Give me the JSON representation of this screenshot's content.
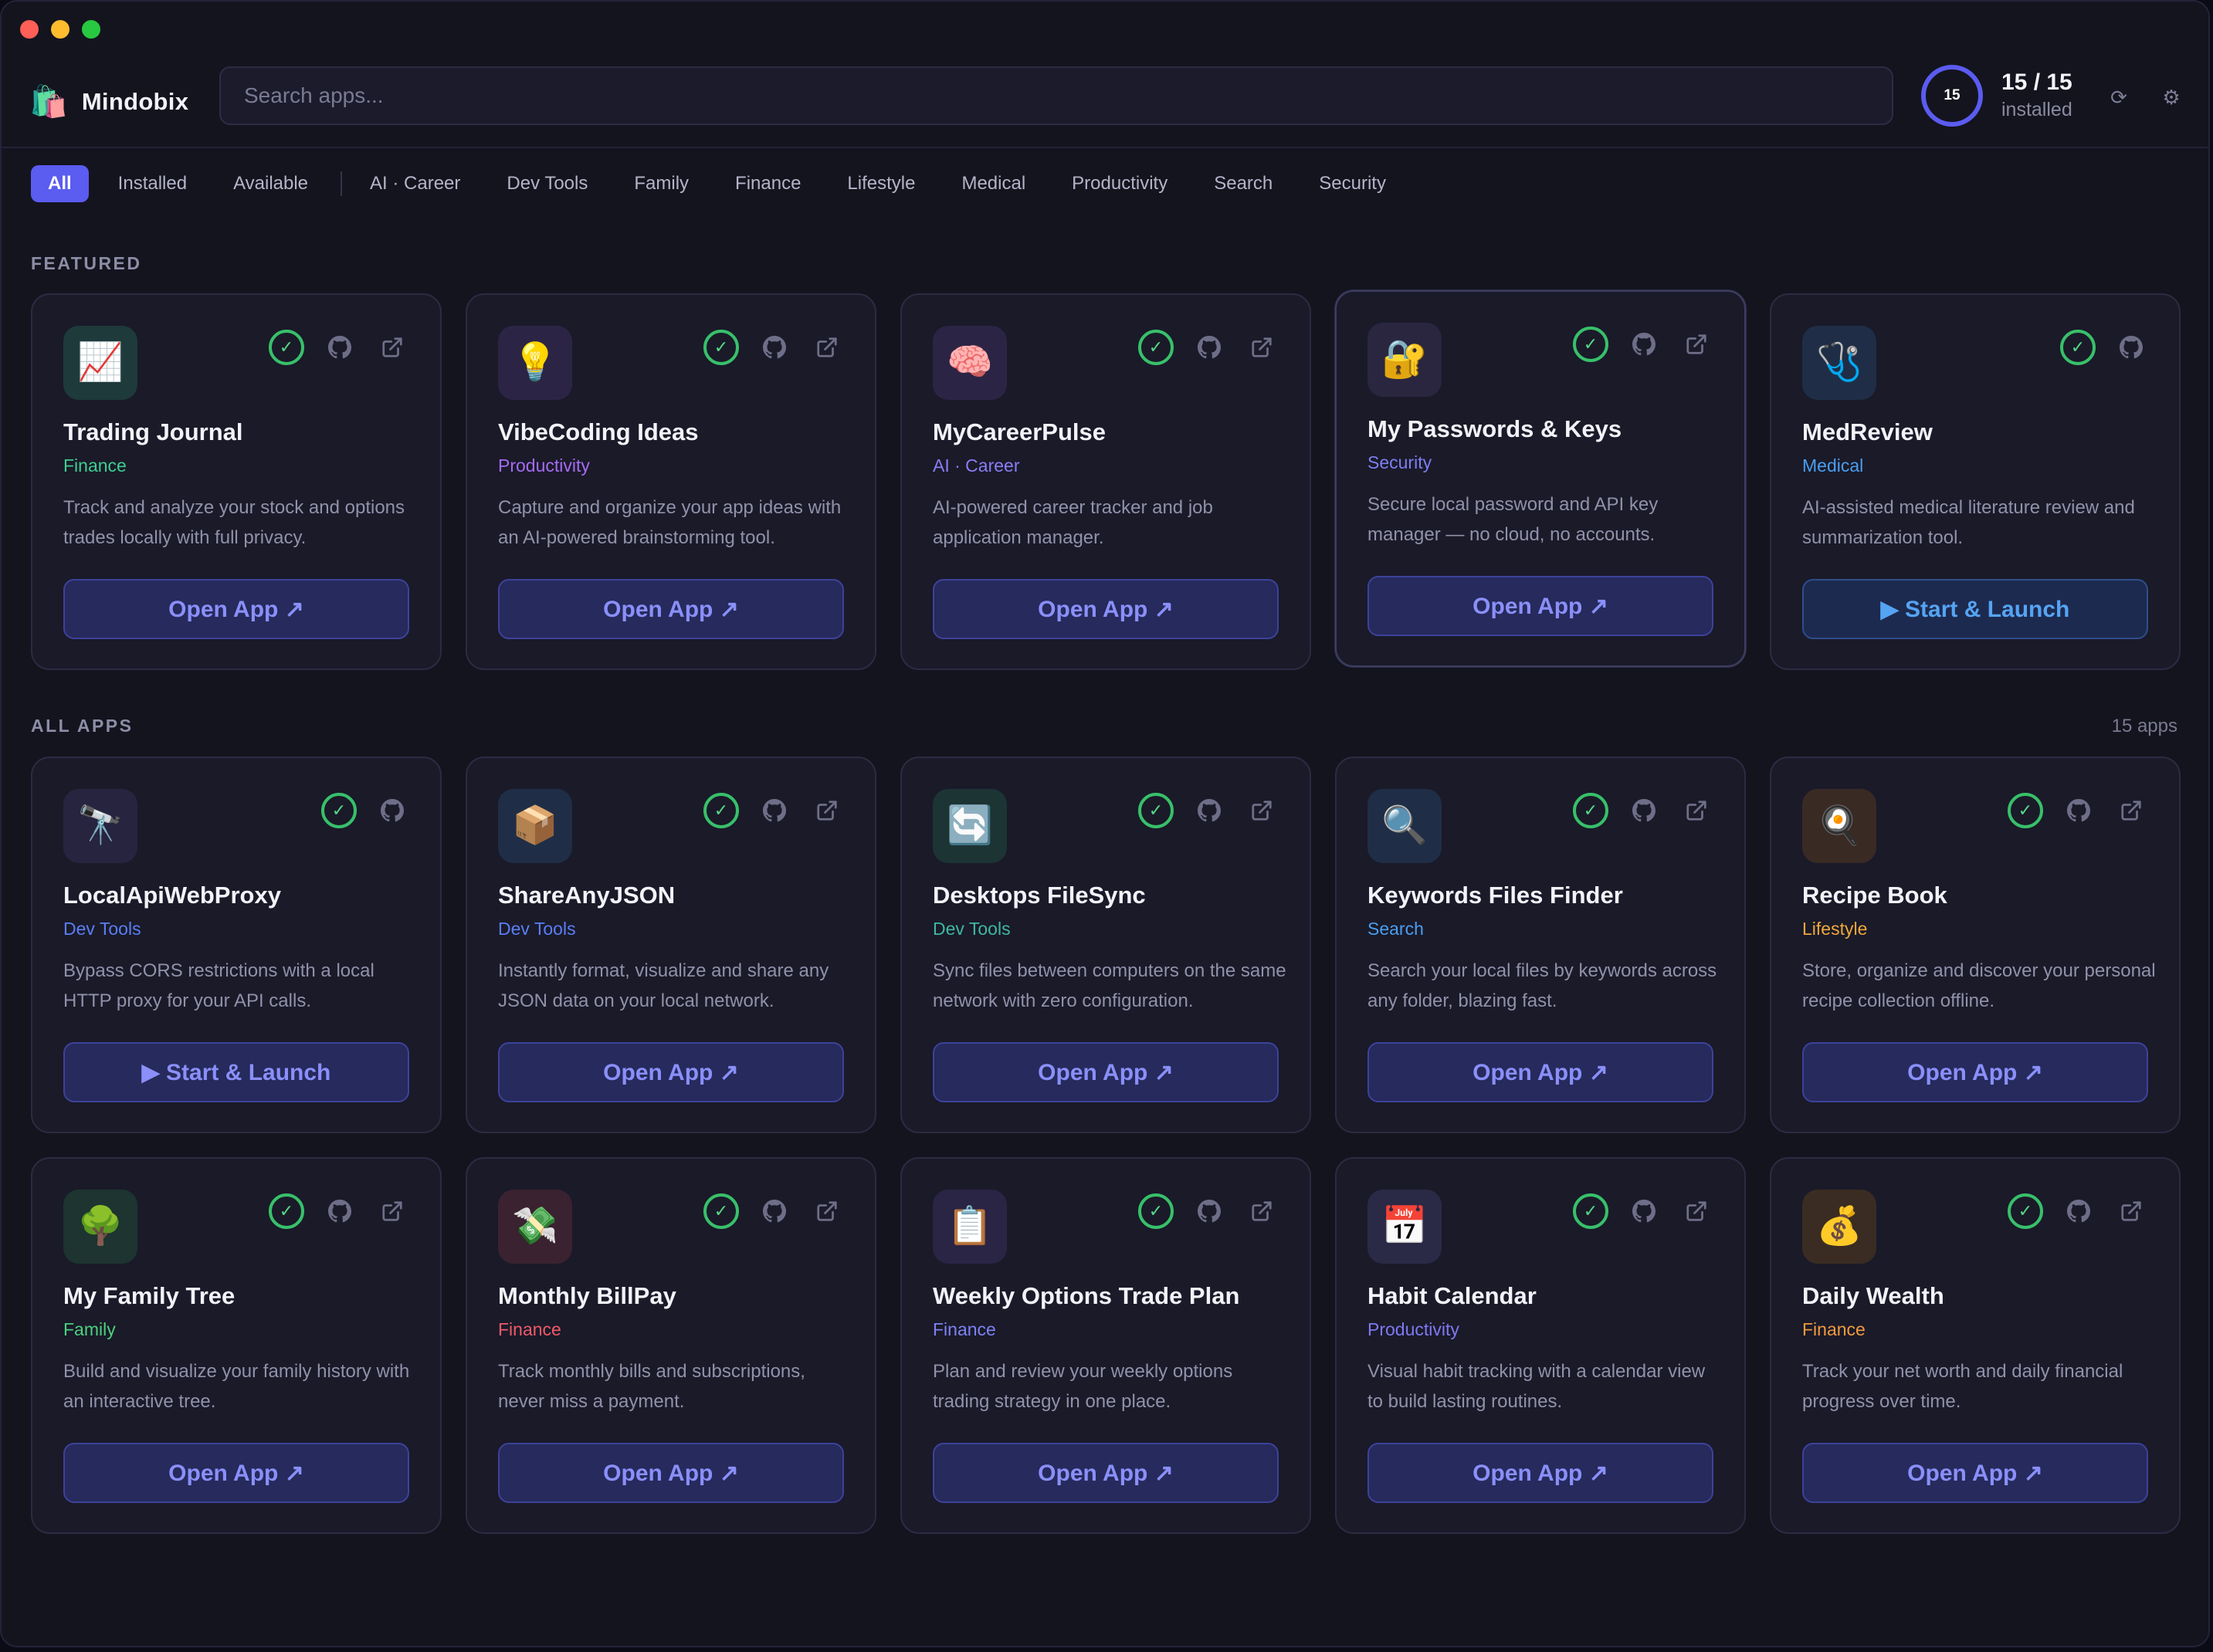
{
  "header": {
    "brand_icon": "🛍️",
    "brand_name": "Mindobix",
    "search_placeholder": "Search apps...",
    "ring_value": "15",
    "installed_count": "15 / 15",
    "installed_label": "installed",
    "refresh_glyph": "⟳",
    "settings_glyph": "⚙"
  },
  "filters": {
    "status": [
      "All",
      "Installed",
      "Available"
    ],
    "categories": [
      "AI · Career",
      "Dev Tools",
      "Family",
      "Finance",
      "Lifestyle",
      "Medical",
      "Productivity",
      "Search",
      "Security"
    ]
  },
  "sections": {
    "featured_label": "FEATURED",
    "all_label": "ALL APPS",
    "all_count": "15 apps"
  },
  "colors": {
    "accent": "#5b5cf0",
    "installed_check": "#38c06a"
  },
  "featured": [
    {
      "name": "Trading Journal",
      "category": "Finance",
      "desc": "Track and analyze your stock and options trades locally with full privacy.",
      "button": "Open App ↗",
      "icon": "📈",
      "icon_name": "chart-up-icon"
    },
    {
      "name": "VibeCoding Ideas",
      "category": "Productivity",
      "desc": "Capture and organize your app ideas with an AI-powered brainstorming tool.",
      "button": "Open App ↗",
      "icon": "💡",
      "icon_name": "lightbulb-icon"
    },
    {
      "name": "MyCareerPulse",
      "category": "AI · Career",
      "desc": "AI-powered career tracker and job application manager.",
      "button": "Open App ↗",
      "icon": "🧠",
      "icon_name": "brain-icon"
    },
    {
      "name": "My Passwords & Keys",
      "category": "Security",
      "desc": "Secure local password and API key manager — no cloud, no accounts.",
      "button": "Open App ↗",
      "icon": "🔐",
      "icon_name": "lock-key-icon"
    },
    {
      "name": "MedReview",
      "category": "Medical",
      "desc": "AI-assisted medical literature review and summarization tool.",
      "button": "▶ Start & Launch",
      "icon": "🩺",
      "icon_name": "stethoscope-icon"
    }
  ],
  "apps": [
    {
      "name": "LocalApiWebProxy",
      "category": "Dev Tools",
      "desc": "Bypass CORS restrictions with a local HTTP proxy for your API calls.",
      "button": "▶ Start & Launch",
      "icon": "🔭",
      "icon_name": "telescope-icon"
    },
    {
      "name": "ShareAnyJSON",
      "category": "Dev Tools",
      "desc": "Instantly format, visualize and share any JSON data on your local network.",
      "button": "Open App ↗",
      "icon": "📦",
      "icon_name": "package-icon"
    },
    {
      "name": "Desktops FileSync",
      "category": "Dev Tools",
      "desc": "Sync files between computers on the same network with zero configuration.",
      "button": "Open App ↗",
      "icon": "🔄",
      "icon_name": "sync-icon"
    },
    {
      "name": "Keywords Files Finder",
      "category": "Search",
      "desc": "Search your local files by keywords across any folder, blazing fast.",
      "button": "Open App ↗",
      "icon": "🔍",
      "icon_name": "magnifier-icon"
    },
    {
      "name": "Recipe Book",
      "category": "Lifestyle",
      "desc": "Store, organize and discover your personal recipe collection offline.",
      "button": "Open App ↗",
      "icon": "🍳",
      "icon_name": "frying-pan-icon"
    },
    {
      "name": "My Family Tree",
      "category": "Family",
      "desc": "Build and visualize your family history with an interactive tree.",
      "button": "Open App ↗",
      "icon": "🌳",
      "icon_name": "tree-icon"
    },
    {
      "name": "Monthly BillPay",
      "category": "Finance",
      "desc": "Track monthly bills and subscriptions, never miss a payment.",
      "button": "Open App ↗",
      "icon": "💸",
      "icon_name": "money-wings-icon"
    },
    {
      "name": "Weekly Options Trade Plan",
      "category": "Finance",
      "desc": "Plan and review your weekly options trading strategy in one place.",
      "button": "Open App ↗",
      "icon": "📋",
      "icon_name": "clipboard-icon"
    },
    {
      "name": "Habit Calendar",
      "category": "Productivity",
      "desc": "Visual habit tracking with a calendar view to build lasting routines.",
      "button": "Open App ↗",
      "icon": "📅",
      "icon_name": "calendar-icon"
    },
    {
      "name": "Daily Wealth",
      "category": "Finance",
      "desc": "Track your net worth and daily financial progress over time.",
      "button": "Open App ↗",
      "icon": "💰",
      "icon_name": "money-bag-icon"
    }
  ]
}
